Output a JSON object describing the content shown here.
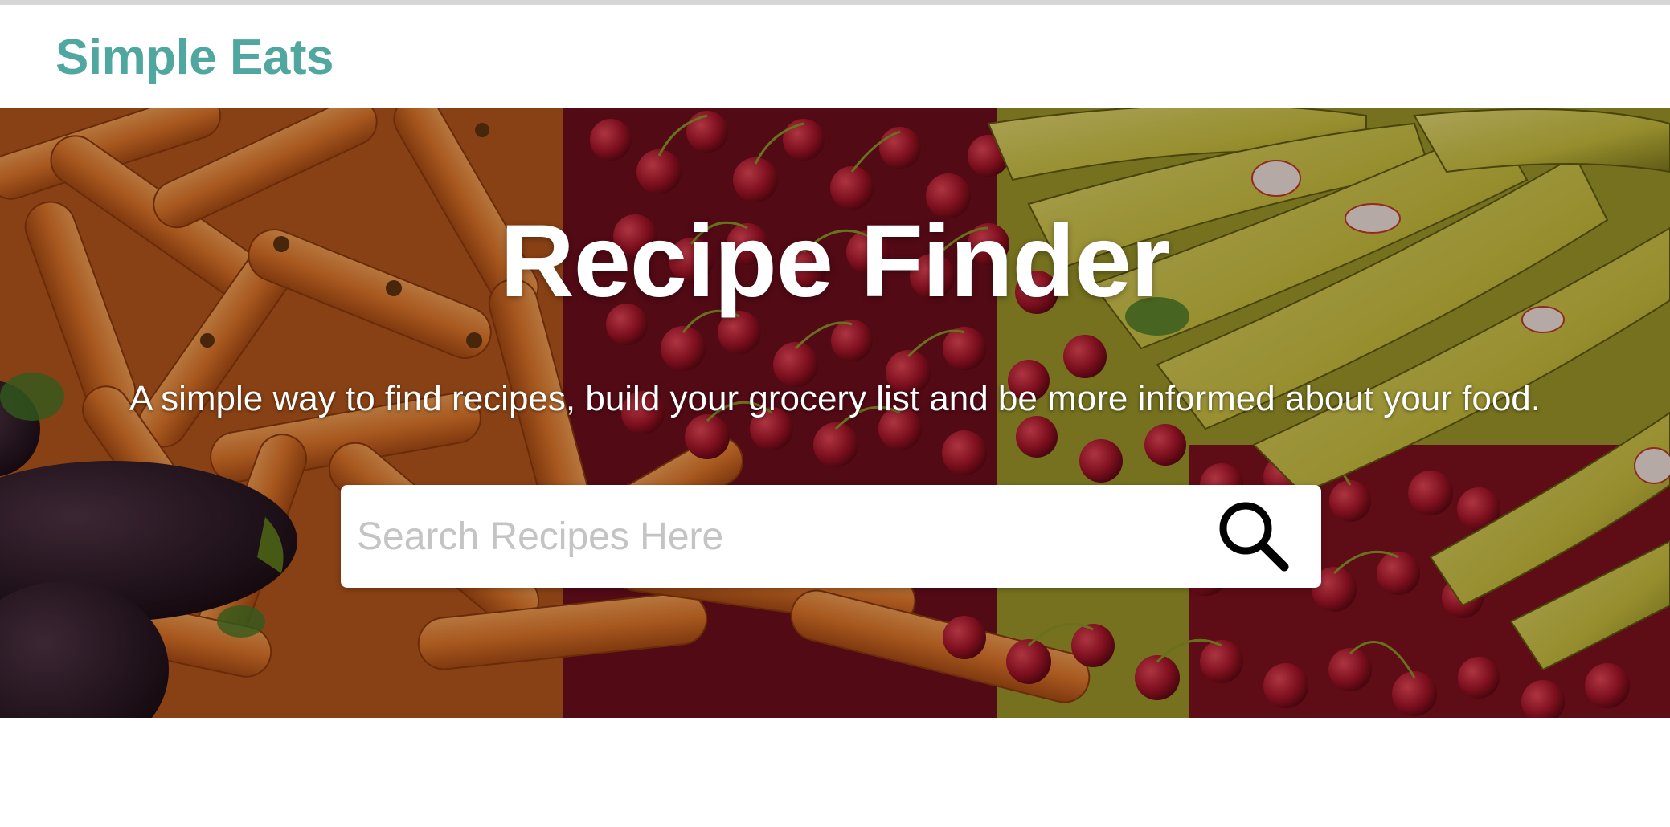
{
  "navbar": {
    "brand": "Simple Eats"
  },
  "hero": {
    "title": "Recipe Finder",
    "subtitle": "A simple way to find recipes, build your grocery list and be more informed about your food.",
    "search": {
      "placeholder": "Search Recipes Here",
      "value": "",
      "button_icon": "search-icon"
    },
    "background_image": "produce-carrots-cherries-bananas-eggplant"
  },
  "colors": {
    "brand": "#4fa79f",
    "hero_text": "#ffffff",
    "placeholder": "#c4c4c4"
  }
}
